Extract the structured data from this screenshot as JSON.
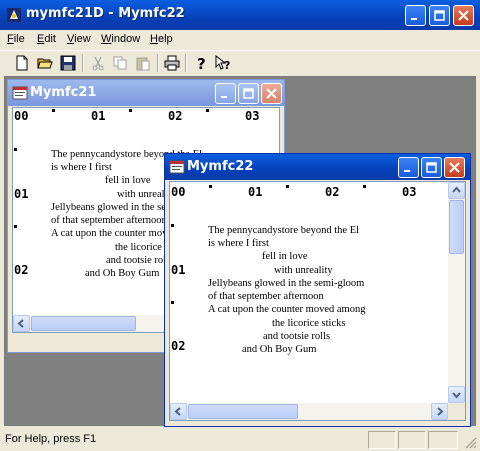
{
  "main_window": {
    "title": "mymfc21D - Mymfc22"
  },
  "menu": [
    {
      "label": "File",
      "underline": "F",
      "rest": "ile"
    },
    {
      "label": "Edit",
      "underline": "E",
      "rest": "dit"
    },
    {
      "label": "View",
      "underline": "V",
      "rest": "iew"
    },
    {
      "label": "Window",
      "underline": "W",
      "rest": "indow"
    },
    {
      "label": "Help",
      "underline": "H",
      "rest": "elp"
    }
  ],
  "toolbar": {
    "icons": [
      "new-file-icon",
      "open-folder-icon",
      "save-icon",
      "cut-icon",
      "copy-icon",
      "paste-icon",
      "print-icon",
      "help-icon",
      "context-help-icon"
    ]
  },
  "status": {
    "text": "For Help, press F1"
  },
  "child_back": {
    "title": "Mymfc21",
    "ruler": [
      "00",
      "01",
      "02",
      "03"
    ],
    "row_labels": [
      "01",
      "02"
    ],
    "lines": [
      "The pennycandystore beyond the El",
      "is where I first",
      "fell in love",
      "with unreality",
      "Jellybeans glowed in the semi-gloom",
      "of that september afternoon",
      "A cat upon the counter moved among",
      "the licorice sticks",
      "and tootsie rolls",
      "and Oh Boy Gum"
    ]
  },
  "child_front": {
    "title": "Mymfc22",
    "ruler": [
      "00",
      "01",
      "02",
      "03"
    ],
    "row_labels": [
      "01",
      "02"
    ],
    "lines": [
      "The pennycandystore beyond the El",
      "is where I first",
      "fell in love",
      "with unreality",
      "Jellybeans glowed in the semi-gloom",
      "of that september afternoon",
      "A cat upon the counter moved among",
      "the licorice sticks",
      "and tootsie rolls",
      "and Oh Boy Gum"
    ]
  }
}
